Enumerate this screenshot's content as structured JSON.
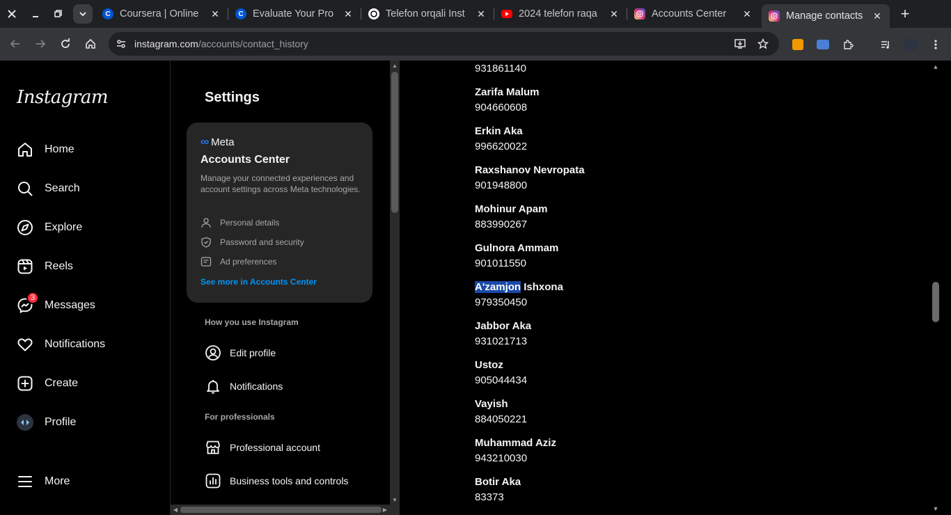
{
  "browser": {
    "tabs": [
      {
        "title": "Coursera | Online",
        "favicon": "coursera-icon",
        "fav_color": "#0056d2",
        "fav_text": "C"
      },
      {
        "title": "Evaluate Your Pro",
        "favicon": "coursera-icon",
        "fav_color": "#0056d2",
        "fav_text": "C"
      },
      {
        "title": "Telefon orqali Inst",
        "favicon": "chatgpt-icon",
        "fav_color": "#ffffff",
        "fav_text": ""
      },
      {
        "title": "2024 telefon raqa",
        "favicon": "youtube-icon",
        "fav_color": "#ff0000",
        "fav_text": ""
      },
      {
        "title": "Accounts Center",
        "favicon": "instagram-icon",
        "fav_color": "#d62976",
        "fav_text": ""
      },
      {
        "title": "Manage contacts",
        "favicon": "instagram-icon",
        "fav_color": "#d62976",
        "fav_text": "",
        "active": true
      }
    ],
    "url_host": "instagram.com",
    "url_path": "/accounts/contact_history"
  },
  "nav": {
    "logo": "Instagram",
    "items": [
      {
        "label": "Home",
        "icon": "home-icon"
      },
      {
        "label": "Search",
        "icon": "search-icon"
      },
      {
        "label": "Explore",
        "icon": "compass-icon"
      },
      {
        "label": "Reels",
        "icon": "reels-icon"
      },
      {
        "label": "Messages",
        "icon": "messenger-icon",
        "badge": "3"
      },
      {
        "label": "Notifications",
        "icon": "heart-icon"
      },
      {
        "label": "Create",
        "icon": "plus-square-icon"
      },
      {
        "label": "Profile",
        "icon": "avatar"
      }
    ],
    "more": "More"
  },
  "settings": {
    "title": "Settings",
    "accounts_center": {
      "brand": "Meta",
      "title": "Accounts Center",
      "description": "Manage your connected experiences and account settings across Meta technologies.",
      "links": [
        "Personal details",
        "Password and security",
        "Ad preferences"
      ],
      "see_more": "See more in Accounts Center"
    },
    "section_how": "How you use Instagram",
    "how_items": [
      "Edit profile",
      "Notifications"
    ],
    "section_pro": "For professionals",
    "pro_items": [
      "Professional account",
      "Business tools and controls"
    ]
  },
  "contacts": {
    "partial_top_number": "931861140",
    "list": [
      {
        "name": "Zarifa Malum",
        "number": "904660608"
      },
      {
        "name": "Erkin Aka",
        "number": "996620022"
      },
      {
        "name": "Raxshanov Nevropata",
        "number": "901948800"
      },
      {
        "name": "Mohinur Apam",
        "number": "883990267"
      },
      {
        "name": "Gulnora Ammam",
        "number": "901011550"
      },
      {
        "name_highlight": "A'zamjon",
        "name_rest": " Ishxona",
        "number": "979350450"
      },
      {
        "name": "Jabbor Aka",
        "number": "931021713"
      },
      {
        "name": "Ustoz",
        "number": "905044434"
      },
      {
        "name": "Vayish",
        "number": "884050221"
      },
      {
        "name": "Muhammad Aziz",
        "number": "943210030"
      },
      {
        "name": "Botir Aka",
        "number": "83373"
      }
    ]
  }
}
